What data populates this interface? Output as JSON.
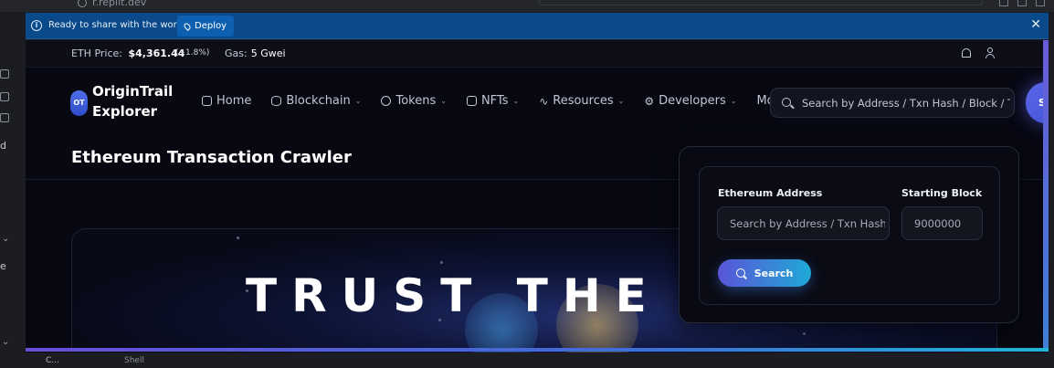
{
  "browser": {
    "url": "r.replit.dev"
  },
  "ide_left": {
    "label_d": "d",
    "label_e": "e"
  },
  "banner": {
    "message": "Ready to share with the world?",
    "deploy_label": "Deploy",
    "close_glyph": "✕"
  },
  "topbar": {
    "eth_label": "ETH Price:",
    "eth_price": "$4,361.44",
    "eth_change": "(+1.8%)",
    "gas_label": "Gas:",
    "gas_value": "5 Gwei"
  },
  "brand": {
    "badge": "OT",
    "name_line1": "OriginTrail",
    "name_line2": "Explorer"
  },
  "nav": {
    "items": [
      {
        "label": "Home",
        "icon": "home-icon",
        "has_dropdown": false
      },
      {
        "label": "Blockchain",
        "icon": "database-icon",
        "has_dropdown": true
      },
      {
        "label": "Tokens",
        "icon": "coins-icon",
        "has_dropdown": true
      },
      {
        "label": "NFTs",
        "icon": "document-icon",
        "has_dropdown": true
      },
      {
        "label": "Resources",
        "icon": "activity-icon",
        "has_dropdown": true
      },
      {
        "label": "Developers",
        "icon": "gear-icon",
        "has_dropdown": true
      },
      {
        "label": "More",
        "icon": "",
        "has_dropdown": true
      }
    ],
    "search_placeholder": "Search by Address / Txn Hash / Block / Tok",
    "signin_label": "S"
  },
  "page": {
    "title": "Ethereum Transaction Crawler",
    "hero_text": "TRUST THE SOU"
  },
  "crawler": {
    "address_label": "Ethereum Address",
    "address_placeholder": "Search by Address / Txn Hash /",
    "block_label": "Starting Block",
    "block_placeholder": "9000000",
    "search_label": "Search"
  },
  "statusbar": {
    "left_text": "C...",
    "right_text": "Shell"
  },
  "colors": {
    "banner_bg": "#0a4a8a",
    "page_bg": "#070812",
    "accent_start": "#5a55d8",
    "accent_end": "#1fa9d6"
  }
}
